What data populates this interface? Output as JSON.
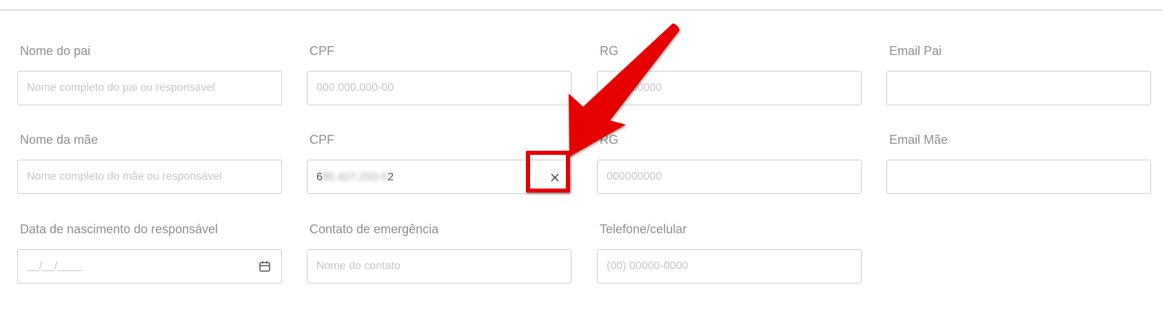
{
  "rows": [
    [
      {
        "label": "Nome do pai",
        "placeholder": "Nome completo do pai ou responsável",
        "value": ""
      },
      {
        "label": "CPF",
        "placeholder": "000.000.000-00",
        "value": ""
      },
      {
        "label": "RG",
        "placeholder": "000000000",
        "value": ""
      },
      {
        "label": "Email Pai",
        "placeholder": "",
        "value": ""
      }
    ],
    [
      {
        "label": "Nome da mãe",
        "placeholder": "Nome completo do mãe ou responsável",
        "value": ""
      },
      {
        "label": "CPF",
        "placeholder": "000.000.000-00",
        "value_visible_start": "6",
        "value_blurred": "85.427.250-5",
        "value_visible_end": "2"
      },
      {
        "label": "RG",
        "placeholder": "000000000",
        "value": ""
      },
      {
        "label": "Email Mãe",
        "placeholder": "",
        "value": ""
      }
    ],
    [
      {
        "label": "Data de nascimento do responsável",
        "placeholder": "__/__/____",
        "value": ""
      },
      {
        "label": "Contato de emergência",
        "placeholder": "Nome do contato",
        "value": ""
      },
      {
        "label": "Telefone/celular",
        "placeholder": "(00) 00000-0000",
        "value": ""
      }
    ]
  ],
  "icons": {
    "clear": "close-icon",
    "calendar": "calendar-icon"
  },
  "annotation": {
    "color": "#e60000",
    "kind": "red arrow pointing to clear button"
  }
}
